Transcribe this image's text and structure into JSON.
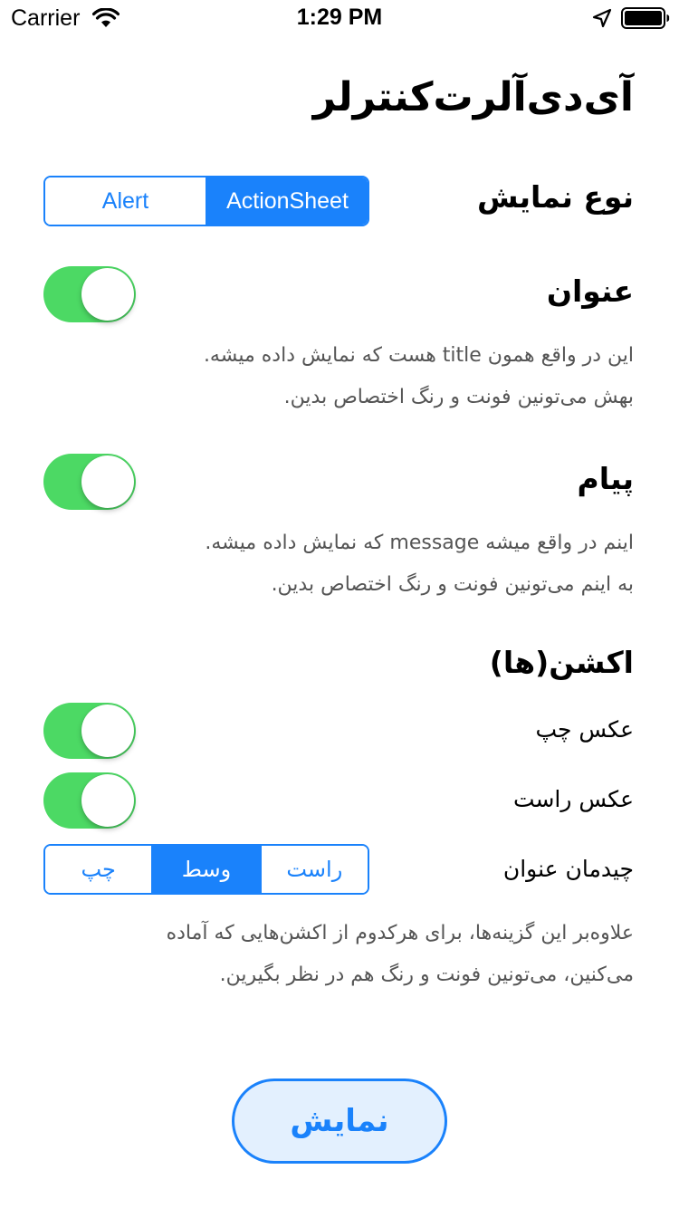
{
  "status_bar": {
    "carrier": "Carrier",
    "time": "1:29 PM"
  },
  "title": "آی‌دی‌آلرت‌کنترلر",
  "display_type": {
    "label": "نوع نمایش",
    "options": [
      "Alert",
      "ActionSheet"
    ],
    "selected": "ActionSheet"
  },
  "title_section": {
    "label": "عنوان",
    "toggle_on": true,
    "description_line1": "این در واقع همون title هست که نمایش داده میشه.",
    "description_line2": "بهش می‌تونین فونت و رنگ اختصاص بدین."
  },
  "message_section": {
    "label": "پیام",
    "toggle_on": true,
    "description_line1": "اینم در واقع میشه message که نمایش داده میشه.",
    "description_line2": "به اینم می‌تونین فونت و رنگ اختصاص بدین."
  },
  "actions_section": {
    "label": "اکشن(ها)",
    "left_image": {
      "label": "عکس چپ",
      "toggle_on": true
    },
    "right_image": {
      "label": "عکس راست",
      "toggle_on": true
    },
    "alignment": {
      "label": "چیدمان عنوان",
      "options": [
        "چپ",
        "وسط",
        "راست"
      ],
      "selected": "وسط"
    },
    "description_line1": "علاوه‌بر این گزینه‌ها، برای هرکدوم از اکشن‌هایی که آماده",
    "description_line2": "می‌کنین، می‌تونین فونت و رنگ هم در نظر بگیرین."
  },
  "show_button": "نمایش",
  "colors": {
    "accent": "#1a82fb",
    "switch_on": "#4cd964",
    "button_bg": "#e3f0fe"
  },
  "icons": [
    "wifi-icon",
    "location-arrow-icon",
    "battery-icon"
  ]
}
